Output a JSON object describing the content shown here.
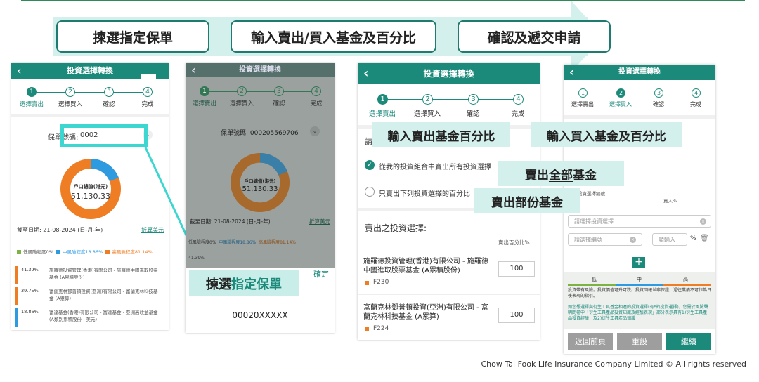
{
  "flow": {
    "step1": "揀選指定保單",
    "step2": "輸入賣出/買入基金及百分比",
    "step3": "確認及遞交申請"
  },
  "screen": {
    "title": "投資選擇轉換",
    "back_icon": "‹",
    "steps": [
      {
        "num": "1",
        "label": "選擇賣出"
      },
      {
        "num": "2",
        "label": "選擇買入"
      },
      {
        "num": "3",
        "label": "確認"
      },
      {
        "num": "4",
        "label": "完成"
      }
    ]
  },
  "p1": {
    "policy_label": "保單號碼:",
    "policy_value": "0002",
    "donut_title": "戶口總值(港元)",
    "donut_value": "51,130.33",
    "date": "截至日期: 21-08-2024 (日-月-年)",
    "convert_link": "折算美元",
    "legend": [
      {
        "label": "低風險程度0%",
        "color": "#7cb342"
      },
      {
        "label": "中風險程度18.86%",
        "color": "#2e9be0"
      },
      {
        "label": "高風險程度81.14%",
        "color": "#ee7d24"
      }
    ],
    "funds": [
      {
        "pct": "41.39%",
        "name": "施羅德投資管理(香港)有限公司 - 施羅德中國進取股票基金 (A累積股份)",
        "color": "#ee7d24"
      },
      {
        "pct": "39.75%",
        "name": "富蘭克林鄧普頓投資(亞洲)有限公司 - 富蘭克林科技基金 (A累算)",
        "color": "#ee7d24"
      },
      {
        "pct": "18.86%",
        "name": "富達基金(香港)有限公司 - 富達基金 - 亞洲高收益基金 (A類別累積股份 - 美元)",
        "color": "#2e9be0"
      }
    ],
    "donut": {
      "high_pct": 81.14,
      "mid_pct": 18.86,
      "low_pct": 0
    }
  },
  "p2": {
    "policy_label": "保單號碼: 000205569706",
    "donut_title": "戶口總值(港元)",
    "donut_value": "51,130.33",
    "date": "截至日期: 21-08-2024 (日-月-年)",
    "convert_link": "折算美元",
    "legend1": "低風險程度0%",
    "legend2": "中風險程度18.86%",
    "legend3": "高風險程度81.14%",
    "row": "41.39%",
    "popup_title": "揀選",
    "popup_title_hl": "指定保單",
    "confirm": "確定",
    "policy_option": "00020XXXXX"
  },
  "p3": {
    "option1": "從我的投資組合中賣出所有投資選擇",
    "option2": "只賣出下列投資選擇的百分比",
    "partial_prefix": "請",
    "section": "賣出之投資選擇:",
    "col_pct": "賣出百分比%",
    "funds": [
      {
        "name": "施羅德投資管理(香港)有限公司 - 施羅德中國進取股票基金 (A累積股份)",
        "code": "F230",
        "value": "100"
      },
      {
        "name": "富蘭克林鄧普頓投資(亞洲)有限公司 - 富蘭克林科技基金 (A累算)",
        "code": "F224",
        "value": "100"
      }
    ]
  },
  "p4": {
    "hdr_code": "投資選擇編號",
    "hdr_pct": "買入%",
    "placeholder_select": "請選擇投資選擇",
    "placeholder_code": "請選擇編號",
    "placeholder_pct": "請輸入",
    "pct_sign": "%",
    "add": "+",
    "risk_low": "低",
    "risk_mid": "中",
    "risk_high": "高",
    "note1": "投資帶有風險。投資價值可升可跌。投資回報並非保證，過往業績不可作為日後表現的指引。",
    "note2": "如您想選擇與衍生工具基金相連的投資選擇(有*的投資選擇)，您需於風險聲明問卷中「衍生工具產品投資知識及經驗表現」部分表示具有1)衍生工具產品投資經驗；及2)衍生工具產品知識",
    "btn_back": "返回前頁",
    "btn_reset": "重設",
    "btn_next": "繼續"
  },
  "callouts": {
    "sell_pct_a": "輸入",
    "sell_pct_b": "賣出",
    "sell_pct_c": "基金百分比",
    "buy_a": "輸入",
    "buy_b": "買入",
    "buy_c": "基金及百分比",
    "all_a": "賣出",
    "all_b": "全部",
    "all_c": "基金",
    "part_a": "賣出",
    "part_b": "部份",
    "part_c": "基金"
  },
  "footer": "Chow Tai Fook Life Insurance Company Limited © All rights reserved",
  "colors": {
    "brand": "#1c8a7b",
    "accent_cyan": "#3dd6d0",
    "callout_bg": "#d4f0ec"
  }
}
